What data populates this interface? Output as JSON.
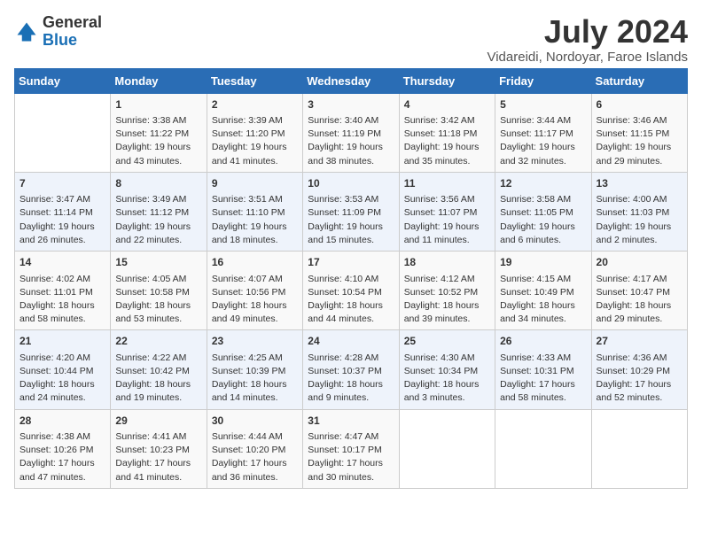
{
  "header": {
    "logo_general": "General",
    "logo_blue": "Blue",
    "month_title": "July 2024",
    "location": "Vidareidi, Nordoyar, Faroe Islands"
  },
  "days_of_week": [
    "Sunday",
    "Monday",
    "Tuesday",
    "Wednesday",
    "Thursday",
    "Friday",
    "Saturday"
  ],
  "weeks": [
    [
      {
        "day": "",
        "info": ""
      },
      {
        "day": "1",
        "info": "Sunrise: 3:38 AM\nSunset: 11:22 PM\nDaylight: 19 hours and 43 minutes."
      },
      {
        "day": "2",
        "info": "Sunrise: 3:39 AM\nSunset: 11:20 PM\nDaylight: 19 hours and 41 minutes."
      },
      {
        "day": "3",
        "info": "Sunrise: 3:40 AM\nSunset: 11:19 PM\nDaylight: 19 hours and 38 minutes."
      },
      {
        "day": "4",
        "info": "Sunrise: 3:42 AM\nSunset: 11:18 PM\nDaylight: 19 hours and 35 minutes."
      },
      {
        "day": "5",
        "info": "Sunrise: 3:44 AM\nSunset: 11:17 PM\nDaylight: 19 hours and 32 minutes."
      },
      {
        "day": "6",
        "info": "Sunrise: 3:46 AM\nSunset: 11:15 PM\nDaylight: 19 hours and 29 minutes."
      }
    ],
    [
      {
        "day": "7",
        "info": "Sunrise: 3:47 AM\nSunset: 11:14 PM\nDaylight: 19 hours and 26 minutes."
      },
      {
        "day": "8",
        "info": "Sunrise: 3:49 AM\nSunset: 11:12 PM\nDaylight: 19 hours and 22 minutes."
      },
      {
        "day": "9",
        "info": "Sunrise: 3:51 AM\nSunset: 11:10 PM\nDaylight: 19 hours and 18 minutes."
      },
      {
        "day": "10",
        "info": "Sunrise: 3:53 AM\nSunset: 11:09 PM\nDaylight: 19 hours and 15 minutes."
      },
      {
        "day": "11",
        "info": "Sunrise: 3:56 AM\nSunset: 11:07 PM\nDaylight: 19 hours and 11 minutes."
      },
      {
        "day": "12",
        "info": "Sunrise: 3:58 AM\nSunset: 11:05 PM\nDaylight: 19 hours and 6 minutes."
      },
      {
        "day": "13",
        "info": "Sunrise: 4:00 AM\nSunset: 11:03 PM\nDaylight: 19 hours and 2 minutes."
      }
    ],
    [
      {
        "day": "14",
        "info": "Sunrise: 4:02 AM\nSunset: 11:01 PM\nDaylight: 18 hours and 58 minutes."
      },
      {
        "day": "15",
        "info": "Sunrise: 4:05 AM\nSunset: 10:58 PM\nDaylight: 18 hours and 53 minutes."
      },
      {
        "day": "16",
        "info": "Sunrise: 4:07 AM\nSunset: 10:56 PM\nDaylight: 18 hours and 49 minutes."
      },
      {
        "day": "17",
        "info": "Sunrise: 4:10 AM\nSunset: 10:54 PM\nDaylight: 18 hours and 44 minutes."
      },
      {
        "day": "18",
        "info": "Sunrise: 4:12 AM\nSunset: 10:52 PM\nDaylight: 18 hours and 39 minutes."
      },
      {
        "day": "19",
        "info": "Sunrise: 4:15 AM\nSunset: 10:49 PM\nDaylight: 18 hours and 34 minutes."
      },
      {
        "day": "20",
        "info": "Sunrise: 4:17 AM\nSunset: 10:47 PM\nDaylight: 18 hours and 29 minutes."
      }
    ],
    [
      {
        "day": "21",
        "info": "Sunrise: 4:20 AM\nSunset: 10:44 PM\nDaylight: 18 hours and 24 minutes."
      },
      {
        "day": "22",
        "info": "Sunrise: 4:22 AM\nSunset: 10:42 PM\nDaylight: 18 hours and 19 minutes."
      },
      {
        "day": "23",
        "info": "Sunrise: 4:25 AM\nSunset: 10:39 PM\nDaylight: 18 hours and 14 minutes."
      },
      {
        "day": "24",
        "info": "Sunrise: 4:28 AM\nSunset: 10:37 PM\nDaylight: 18 hours and 9 minutes."
      },
      {
        "day": "25",
        "info": "Sunrise: 4:30 AM\nSunset: 10:34 PM\nDaylight: 18 hours and 3 minutes."
      },
      {
        "day": "26",
        "info": "Sunrise: 4:33 AM\nSunset: 10:31 PM\nDaylight: 17 hours and 58 minutes."
      },
      {
        "day": "27",
        "info": "Sunrise: 4:36 AM\nSunset: 10:29 PM\nDaylight: 17 hours and 52 minutes."
      }
    ],
    [
      {
        "day": "28",
        "info": "Sunrise: 4:38 AM\nSunset: 10:26 PM\nDaylight: 17 hours and 47 minutes."
      },
      {
        "day": "29",
        "info": "Sunrise: 4:41 AM\nSunset: 10:23 PM\nDaylight: 17 hours and 41 minutes."
      },
      {
        "day": "30",
        "info": "Sunrise: 4:44 AM\nSunset: 10:20 PM\nDaylight: 17 hours and 36 minutes."
      },
      {
        "day": "31",
        "info": "Sunrise: 4:47 AM\nSunset: 10:17 PM\nDaylight: 17 hours and 30 minutes."
      },
      {
        "day": "",
        "info": ""
      },
      {
        "day": "",
        "info": ""
      },
      {
        "day": "",
        "info": ""
      }
    ]
  ]
}
